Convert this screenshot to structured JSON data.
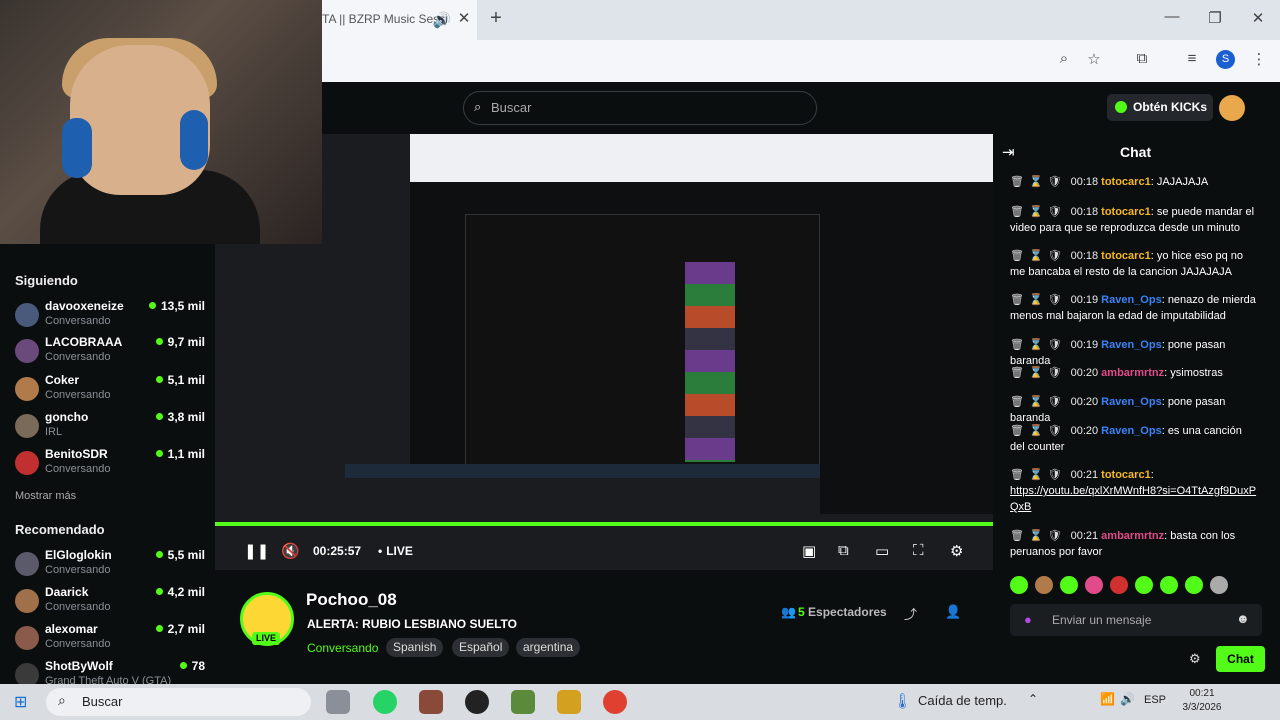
{
  "browser": {
    "tab_title": "TA || BZRP Music Sessi"
  },
  "header": {
    "search_placeholder": "Buscar",
    "kicks_button": "Obtén KICKs"
  },
  "sidebar": {
    "following_title": "Siguiendo",
    "following": [
      {
        "name": "davooxeneize",
        "sub": "Conversando",
        "count": "13,5 mil"
      },
      {
        "name": "LACOBRAAA",
        "sub": "Conversando",
        "count": "9,7 mil"
      },
      {
        "name": "Coker",
        "sub": "Conversando",
        "count": "5,1 mil"
      },
      {
        "name": "goncho",
        "sub": "IRL",
        "count": "3,8 mil"
      },
      {
        "name": "BenitoSDR",
        "sub": "Conversando",
        "count": "1,1 mil"
      }
    ],
    "show_more": "Mostrar más",
    "recommended_title": "Recomendado",
    "recommended": [
      {
        "name": "ElGloglokin",
        "sub": "Conversando",
        "count": "5,5 mil"
      },
      {
        "name": "Daarick",
        "sub": "Conversando",
        "count": "4,2 mil"
      },
      {
        "name": "alexomar",
        "sub": "Conversando",
        "count": "2,7 mil"
      },
      {
        "name": "ShotByWolf",
        "sub": "Grand Theft Auto V (GTA)",
        "count": "78"
      }
    ]
  },
  "player": {
    "timecode": "00:25:57",
    "live_label": "LIVE",
    "progress": 1.0
  },
  "stream": {
    "streamer": "Pochoo_08",
    "live_badge": "LIVE",
    "title": "ALERTA: RUBIO LESBIANO SUELTO",
    "category": "Conversando",
    "tags": [
      "Spanish",
      "Español",
      "argentina"
    ],
    "viewers_count": "5",
    "viewers_label": "Espectadores"
  },
  "chat": {
    "title": "Chat",
    "messages": [
      {
        "time": "00:18",
        "user": "totocarc1",
        "user_color": "#f5b820",
        "text": ": JAJAJAJA"
      },
      {
        "time": "00:18",
        "user": "totocarc1",
        "user_color": "#f5b820",
        "text": ": se puede mandar el video para que se reproduzca desde un minuto"
      },
      {
        "time": "00:18",
        "user": "totocarc1",
        "user_color": "#f5b820",
        "text": ": yo hice eso pq no me bancaba el resto de la cancion JAJAJAJA"
      },
      {
        "time": "00:19",
        "user": "Raven_Ops",
        "user_color": "#3b82f6",
        "text": ": nenazo de mierda menos mal bajaron la edad de imputabilidad"
      },
      {
        "time": "00:19",
        "user": "Raven_Ops",
        "user_color": "#3b82f6",
        "text": ": pone pasan baranda"
      },
      {
        "time": "00:20",
        "user": "ambarmrtnz",
        "user_color": "#e14b8a",
        "text": ": ysimostras"
      },
      {
        "time": "00:20",
        "user": "Raven_Ops",
        "user_color": "#3b82f6",
        "text": ": pone pasan baranda"
      },
      {
        "time": "00:20",
        "user": "Raven_Ops",
        "user_color": "#3b82f6",
        "text": ": es una canción del counter"
      },
      {
        "time": "00:21",
        "user": "totocarc1",
        "user_color": "#f5b820",
        "text": ":",
        "link": "https://youtu.be/qxlXrMWnfH8?si=O4TtAzgf9DuxPQxB"
      },
      {
        "time": "00:21",
        "user": "ambarmrtnz",
        "user_color": "#e14b8a",
        "text": ": basta con los peruanos por favor"
      }
    ],
    "input_placeholder": "Enviar un mensaje",
    "send_button": "Chat"
  },
  "taskbar": {
    "search_label": "Buscar",
    "weather": "Caída de temp.",
    "lang": "ESP",
    "time": "00:21",
    "date": "3/3/2026"
  },
  "colors": {
    "accent": "#53fc18",
    "background": "#0b0e0f"
  }
}
